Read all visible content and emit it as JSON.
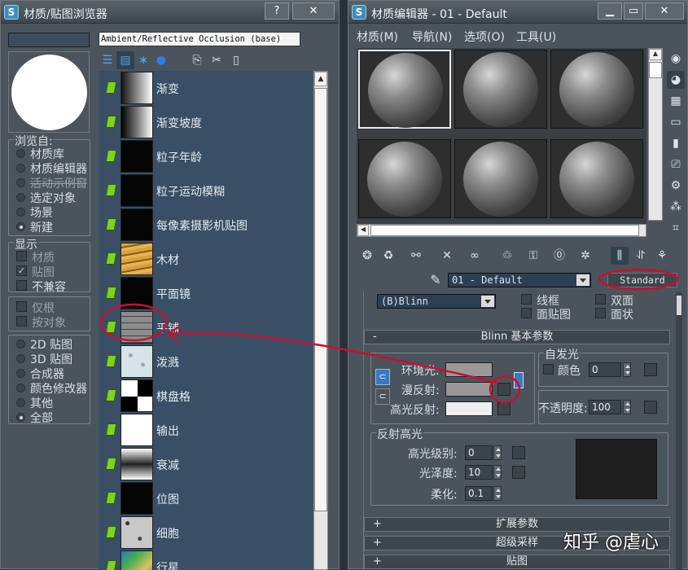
{
  "browser": {
    "title": "材质/贴图浏览器",
    "help_btn": "?",
    "close_btn": "✕",
    "map_name": "Ambient/Reflective Occlusion (base)",
    "browse_from_label": "浏览自:",
    "browse_from": [
      "材质库",
      "材质编辑器",
      "活动示例窗",
      "选定对象",
      "场景",
      "新建"
    ],
    "browse_selected": 5,
    "show_label": "显示",
    "show": [
      {
        "label": "材质",
        "checked": false,
        "dim": true
      },
      {
        "label": "贴图",
        "checked": true,
        "dim": true
      },
      {
        "label": "不兼容",
        "checked": false,
        "dim": false
      }
    ],
    "options": [
      {
        "label": "仅根",
        "dim": true
      },
      {
        "label": "按对象",
        "dim": true
      }
    ],
    "categories": [
      "2D 贴图",
      "3D 贴图",
      "合成器",
      "颜色修改器",
      "其他",
      "全部"
    ],
    "category_selected": 5,
    "maps": [
      "渐变",
      "渐变坡度",
      "粒子年龄",
      "粒子运动模糊",
      "每像素摄影机贴图",
      "木材",
      "平面镜",
      "平铺",
      "泼溅",
      "棋盘格",
      "输出",
      "衰减",
      "位图",
      "细胞",
      "行星"
    ],
    "map_thumbs": [
      "grad",
      "gradramp",
      "black",
      "black",
      "black",
      "wood",
      "black",
      "tiles",
      "splat",
      "checker",
      "white",
      "falloff",
      "black",
      "cellular",
      "planet"
    ]
  },
  "editor": {
    "title": "材质编辑器 - 01 - Default",
    "menu": [
      "材质(M)",
      "导航(N)",
      "选项(O)",
      "工具(U)"
    ],
    "material_name": "01 - Default",
    "material_type": "Standard",
    "shader": "(B)Blinn",
    "shader_options": [
      "线框",
      "双面",
      "面贴图",
      "面状"
    ],
    "blinn_header": "Blinn 基本参数",
    "self_illum_label": "自发光",
    "color_label": "颜色",
    "color_value": "0",
    "ambient_label": "环境光:",
    "diffuse_label": "漫反射:",
    "specular_label": "高光反射:",
    "opacity_label": "不透明度:",
    "opacity_value": "100",
    "highlights_label": "反射高光",
    "spec_level_label": "高光级别:",
    "spec_level_value": "0",
    "gloss_label": "光泽度:",
    "gloss_value": "10",
    "soften_label": "柔化:",
    "soften_value": "0.1",
    "rollouts": [
      "扩展参数",
      "超级采样",
      "贴图"
    ],
    "collapse_sign": "-",
    "expand_sign": "+"
  },
  "watermark": "知乎 @虐心"
}
